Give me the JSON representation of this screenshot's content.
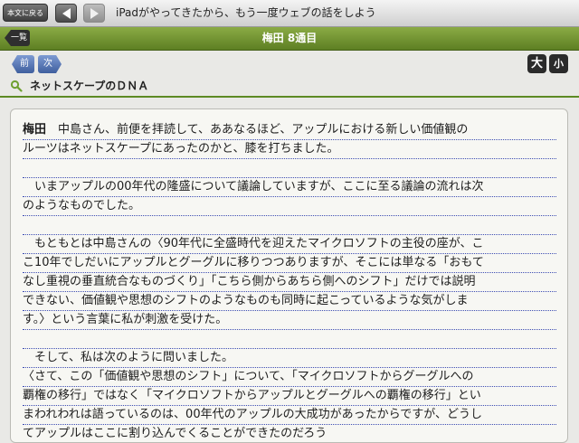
{
  "toolbar": {
    "back_label": "本文に戻る",
    "title": "iPadがやってきたから、もう一度ウェブの話をしよう"
  },
  "section": {
    "index_label": "一覧",
    "title": "梅田 8通目"
  },
  "nav": {
    "prev_label": "前",
    "next_label": "次",
    "font_large": "大",
    "font_small": "小"
  },
  "subheading": "ネットスケープのＤＮＡ",
  "body": {
    "speaker": "梅田",
    "lines": [
      "　中島さん、前便を拝読して、ああなるほど、アップルにおける新しい価値観の",
      "ルーツはネットスケープにあったのかと、膝を打ちました。",
      "",
      "　いまアップルの00年代の隆盛について議論していますが、ここに至る議論の流れは次",
      "のようなものでした。",
      "",
      "　もともとは中島さんの〈90年代に全盛時代を迎えたマイクロソフトの主役の座が、こ",
      "こ10年でしだいにアップルとグーグルに移りつつありますが、そこには単なる「おもて",
      "なし重視の垂直統合なものづくり」「こちら側からあちら側へのシフト」だけでは説明",
      "できない、価値観や思想のシフトのようなものも同時に起こっているような気がしま",
      "す。〉という言葉に私が刺激を受けた。",
      "",
      "　そして、私は次のように問いました。",
      "〈さて、この「価値観や思想のシフト」について、「マイクロソフトからグーグルへの",
      "覇権の移行」ではなく「マイクロソフトからアップルとグーグルへの覇権の移行」とい",
      "まわれわれは語っているのは、00年代のアップルの大成功があったからですが、どうし",
      "てアップルはここに割り込んでくることができたのだろう"
    ]
  },
  "colors": {
    "green_bar": "#6b8e2f",
    "rule_blue": "#3e4eb3",
    "nav_blue": "#4f6fb0"
  }
}
